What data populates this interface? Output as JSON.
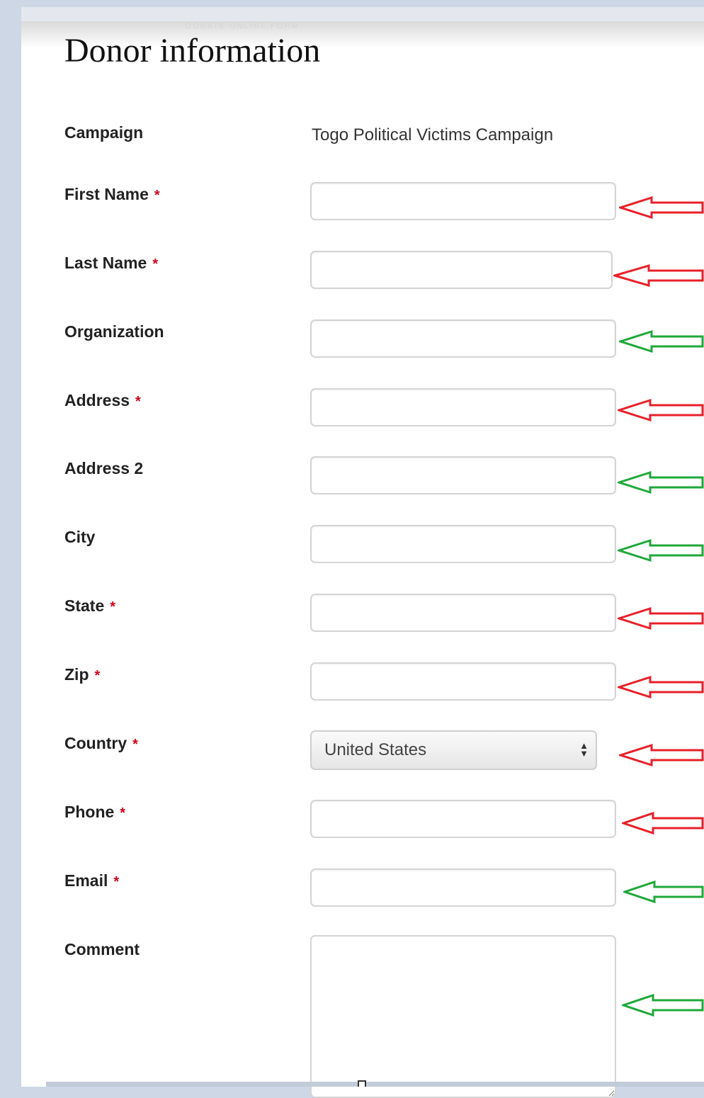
{
  "page": {
    "title": "Donor information"
  },
  "form": {
    "campaign": {
      "label": "Campaign",
      "value": "Togo Political Victims Campaign"
    },
    "fields": {
      "first_name": {
        "label": "First Name",
        "required_mark": "*",
        "value": ""
      },
      "last_name": {
        "label": "Last Name",
        "required_mark": "*",
        "value": ""
      },
      "organization": {
        "label": "Organization",
        "value": ""
      },
      "address": {
        "label": "Address",
        "required_mark": "*",
        "value": ""
      },
      "address2": {
        "label": "Address 2",
        "value": ""
      },
      "city": {
        "label": "City",
        "value": ""
      },
      "state": {
        "label": "State",
        "required_mark": "*",
        "value": ""
      },
      "zip": {
        "label": "Zip",
        "required_mark": "*",
        "value": ""
      },
      "country": {
        "label": "Country",
        "required_mark": "*",
        "selected": "United States"
      },
      "phone": {
        "label": "Phone",
        "required_mark": "*",
        "value": ""
      },
      "email": {
        "label": "Email",
        "required_mark": "*",
        "value": ""
      },
      "comment": {
        "label": "Comment",
        "value": ""
      }
    }
  },
  "annotations": {
    "required_arrow_color": "#e8202a",
    "optional_arrow_color": "#1fa83a",
    "arrow_icon": "left-arrow-icon"
  },
  "colors": {
    "required_asterisk": "#d0021b",
    "background": "#cdd7e6"
  }
}
